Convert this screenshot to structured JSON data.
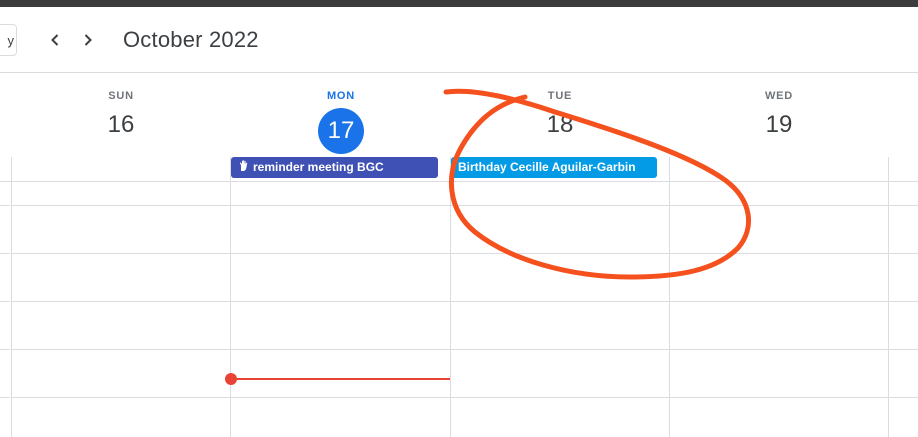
{
  "header": {
    "today_label": "y",
    "prev_icon": "chevron-left-icon",
    "next_icon": "chevron-right-icon",
    "title": "October 2022"
  },
  "days": [
    {
      "dow": "SUN",
      "num": "16"
    },
    {
      "dow": "MON",
      "num": "17",
      "today": true
    },
    {
      "dow": "TUE",
      "num": "18"
    },
    {
      "dow": "WED",
      "num": "19"
    }
  ],
  "events": [
    {
      "title": "reminder meeting BGC",
      "day": "MON",
      "color": "#3f51b5",
      "icon": "hand-icon"
    },
    {
      "title": "Birthday Cecille Aguilar-Garbin",
      "day": "TUE",
      "color": "#039be5"
    }
  ],
  "colors": {
    "accent": "#1a73e8",
    "now_indicator": "#ea4335",
    "annotation": "#f4511e"
  }
}
